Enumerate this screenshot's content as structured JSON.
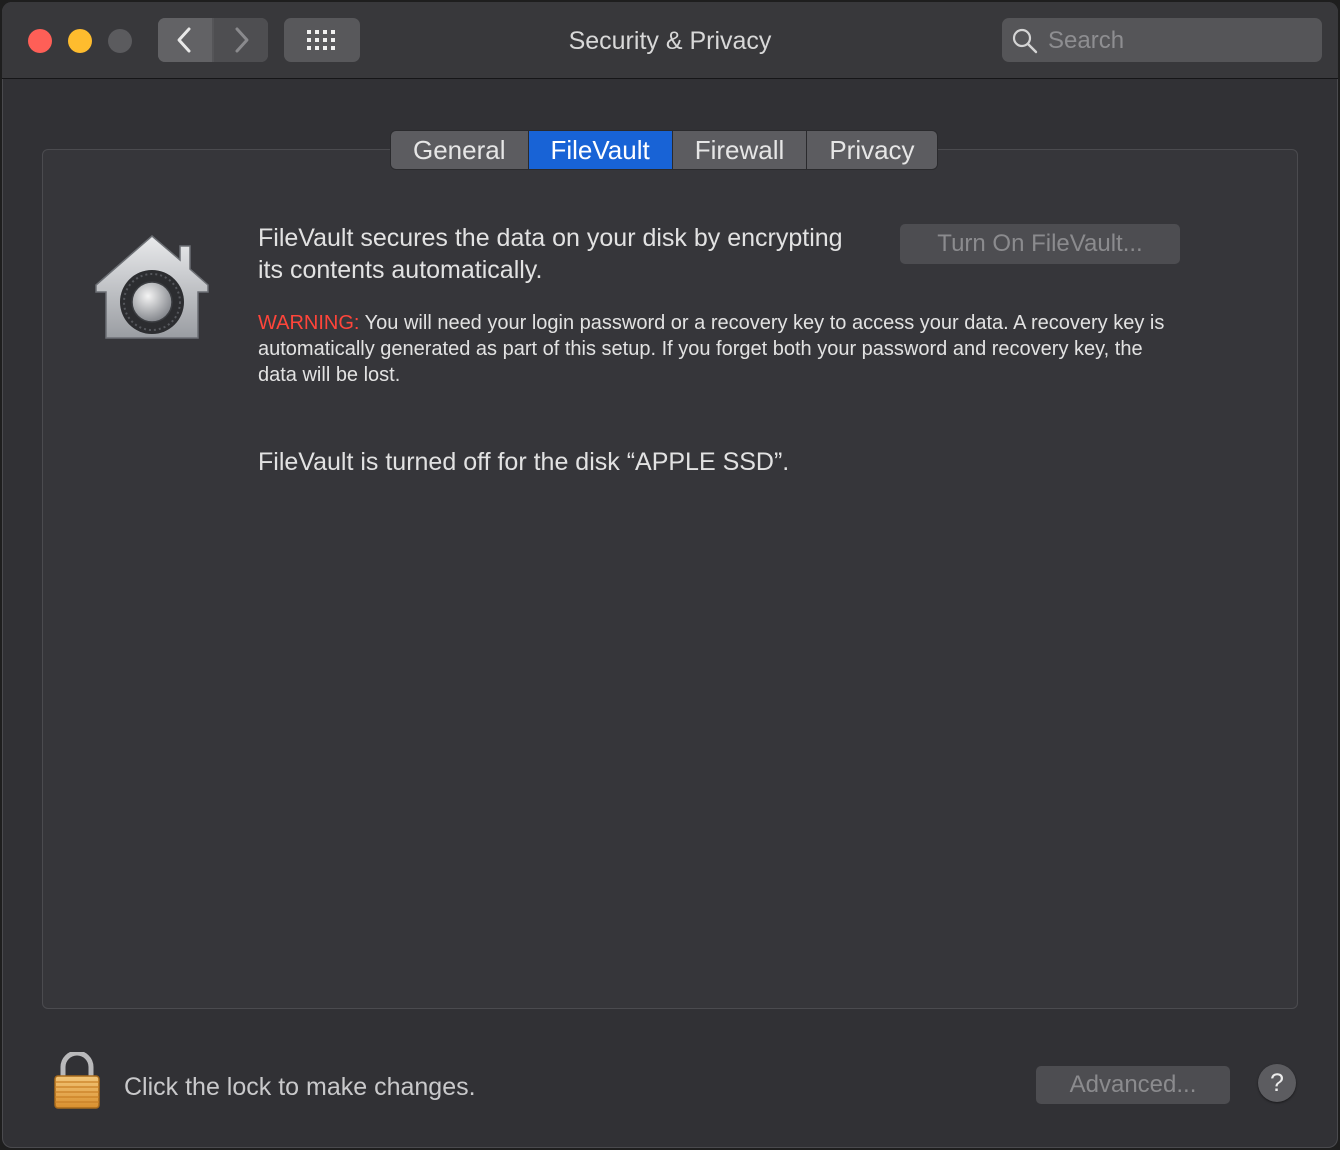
{
  "window": {
    "title": "Security & Privacy"
  },
  "toolbar": {
    "back_icon": "chevron-left-icon",
    "forward_icon": "chevron-right-icon",
    "grid_icon": "show-all-grid-icon",
    "search_placeholder": "Search",
    "search_value": ""
  },
  "tabs": [
    {
      "label": "General",
      "active": false
    },
    {
      "label": "FileVault",
      "active": true
    },
    {
      "label": "Firewall",
      "active": false
    },
    {
      "label": "Privacy",
      "active": false
    }
  ],
  "filevault": {
    "description": "FileVault secures the data on your disk by encrypting its contents automatically.",
    "turn_on_label": "Turn On FileVault...",
    "warning_label": "WARNING:",
    "warning_text": " You will need your login password or a recovery key to access your data. A recovery key is automatically generated as part of this setup. If you forget both your password and recovery key, the data will be lost.",
    "status": "FileVault is turned off for the disk “APPLE SSD”."
  },
  "footer": {
    "lock_message": "Click the lock to make changes.",
    "advanced_label": "Advanced...",
    "help_label": "?"
  },
  "colors": {
    "accent": "#1863d6",
    "warning": "#ff453a",
    "close": "#fe5f57",
    "minimize": "#febc2e"
  }
}
